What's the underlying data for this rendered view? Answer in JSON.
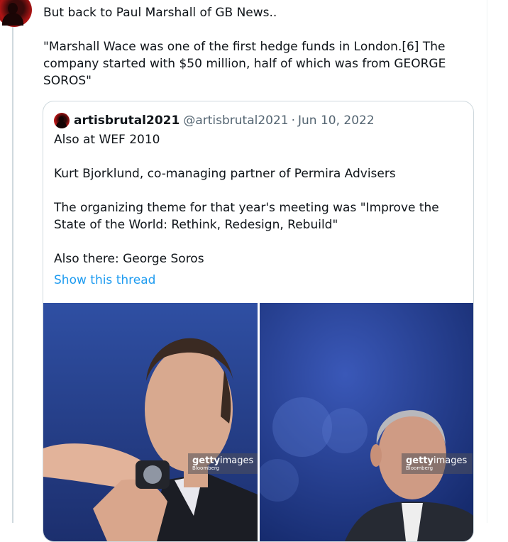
{
  "tweet": {
    "paragraphs": [
      "But back to Paul Marshall of GB News..",
      "\"Marshall Wace was one of the first hedge funds in London.[6] The company started with $50 million, half of which was from GEORGE SOROS\""
    ]
  },
  "quote": {
    "name": "artisbrutal2021",
    "handle": "@artisbrutal2021",
    "separator": "·",
    "date": "Jun 10, 2022",
    "paragraphs": [
      "Also at WEF 2010",
      "Kurt Bjorklund, co-managing partner of Permira Advisers",
      "The organizing theme for that year's meeting was \"Improve the State of the World: Rethink, Redesign, Rebuild\"",
      "Also there: George Soros"
    ],
    "show_thread": "Show this thread"
  },
  "media": {
    "left": {
      "watermark_bold": "getty",
      "watermark_rest": "images",
      "watermark_sub": "Bloomberg"
    },
    "right": {
      "watermark_bold": "getty",
      "watermark_rest": "images",
      "watermark_sub": "Bloomberg"
    }
  },
  "colors": {
    "link": "#1d9bf0",
    "secondary_text": "#536471",
    "border": "#cfd9de",
    "avatar": "#b01515"
  }
}
